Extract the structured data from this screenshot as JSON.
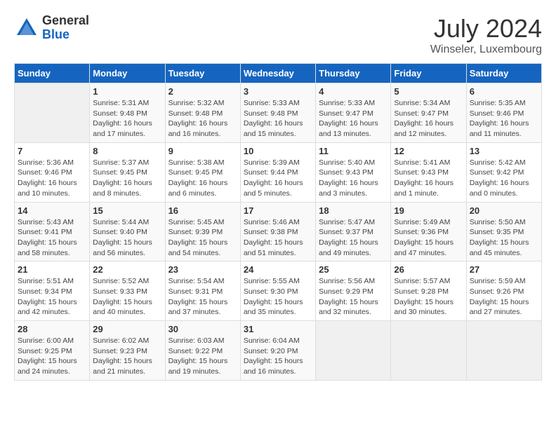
{
  "logo": {
    "general": "General",
    "blue": "Blue"
  },
  "title": "July 2024",
  "subtitle": "Winseler, Luxembourg",
  "days_of_week": [
    "Sunday",
    "Monday",
    "Tuesday",
    "Wednesday",
    "Thursday",
    "Friday",
    "Saturday"
  ],
  "weeks": [
    [
      {
        "day": "",
        "info": ""
      },
      {
        "day": "1",
        "info": "Sunrise: 5:31 AM\nSunset: 9:48 PM\nDaylight: 16 hours\nand 17 minutes."
      },
      {
        "day": "2",
        "info": "Sunrise: 5:32 AM\nSunset: 9:48 PM\nDaylight: 16 hours\nand 16 minutes."
      },
      {
        "day": "3",
        "info": "Sunrise: 5:33 AM\nSunset: 9:48 PM\nDaylight: 16 hours\nand 15 minutes."
      },
      {
        "day": "4",
        "info": "Sunrise: 5:33 AM\nSunset: 9:47 PM\nDaylight: 16 hours\nand 13 minutes."
      },
      {
        "day": "5",
        "info": "Sunrise: 5:34 AM\nSunset: 9:47 PM\nDaylight: 16 hours\nand 12 minutes."
      },
      {
        "day": "6",
        "info": "Sunrise: 5:35 AM\nSunset: 9:46 PM\nDaylight: 16 hours\nand 11 minutes."
      }
    ],
    [
      {
        "day": "7",
        "info": "Sunrise: 5:36 AM\nSunset: 9:46 PM\nDaylight: 16 hours\nand 10 minutes."
      },
      {
        "day": "8",
        "info": "Sunrise: 5:37 AM\nSunset: 9:45 PM\nDaylight: 16 hours\nand 8 minutes."
      },
      {
        "day": "9",
        "info": "Sunrise: 5:38 AM\nSunset: 9:45 PM\nDaylight: 16 hours\nand 6 minutes."
      },
      {
        "day": "10",
        "info": "Sunrise: 5:39 AM\nSunset: 9:44 PM\nDaylight: 16 hours\nand 5 minutes."
      },
      {
        "day": "11",
        "info": "Sunrise: 5:40 AM\nSunset: 9:43 PM\nDaylight: 16 hours\nand 3 minutes."
      },
      {
        "day": "12",
        "info": "Sunrise: 5:41 AM\nSunset: 9:43 PM\nDaylight: 16 hours\nand 1 minute."
      },
      {
        "day": "13",
        "info": "Sunrise: 5:42 AM\nSunset: 9:42 PM\nDaylight: 16 hours\nand 0 minutes."
      }
    ],
    [
      {
        "day": "14",
        "info": "Sunrise: 5:43 AM\nSunset: 9:41 PM\nDaylight: 15 hours\nand 58 minutes."
      },
      {
        "day": "15",
        "info": "Sunrise: 5:44 AM\nSunset: 9:40 PM\nDaylight: 15 hours\nand 56 minutes."
      },
      {
        "day": "16",
        "info": "Sunrise: 5:45 AM\nSunset: 9:39 PM\nDaylight: 15 hours\nand 54 minutes."
      },
      {
        "day": "17",
        "info": "Sunrise: 5:46 AM\nSunset: 9:38 PM\nDaylight: 15 hours\nand 51 minutes."
      },
      {
        "day": "18",
        "info": "Sunrise: 5:47 AM\nSunset: 9:37 PM\nDaylight: 15 hours\nand 49 minutes."
      },
      {
        "day": "19",
        "info": "Sunrise: 5:49 AM\nSunset: 9:36 PM\nDaylight: 15 hours\nand 47 minutes."
      },
      {
        "day": "20",
        "info": "Sunrise: 5:50 AM\nSunset: 9:35 PM\nDaylight: 15 hours\nand 45 minutes."
      }
    ],
    [
      {
        "day": "21",
        "info": "Sunrise: 5:51 AM\nSunset: 9:34 PM\nDaylight: 15 hours\nand 42 minutes."
      },
      {
        "day": "22",
        "info": "Sunrise: 5:52 AM\nSunset: 9:33 PM\nDaylight: 15 hours\nand 40 minutes."
      },
      {
        "day": "23",
        "info": "Sunrise: 5:54 AM\nSunset: 9:31 PM\nDaylight: 15 hours\nand 37 minutes."
      },
      {
        "day": "24",
        "info": "Sunrise: 5:55 AM\nSunset: 9:30 PM\nDaylight: 15 hours\nand 35 minutes."
      },
      {
        "day": "25",
        "info": "Sunrise: 5:56 AM\nSunset: 9:29 PM\nDaylight: 15 hours\nand 32 minutes."
      },
      {
        "day": "26",
        "info": "Sunrise: 5:57 AM\nSunset: 9:28 PM\nDaylight: 15 hours\nand 30 minutes."
      },
      {
        "day": "27",
        "info": "Sunrise: 5:59 AM\nSunset: 9:26 PM\nDaylight: 15 hours\nand 27 minutes."
      }
    ],
    [
      {
        "day": "28",
        "info": "Sunrise: 6:00 AM\nSunset: 9:25 PM\nDaylight: 15 hours\nand 24 minutes."
      },
      {
        "day": "29",
        "info": "Sunrise: 6:02 AM\nSunset: 9:23 PM\nDaylight: 15 hours\nand 21 minutes."
      },
      {
        "day": "30",
        "info": "Sunrise: 6:03 AM\nSunset: 9:22 PM\nDaylight: 15 hours\nand 19 minutes."
      },
      {
        "day": "31",
        "info": "Sunrise: 6:04 AM\nSunset: 9:20 PM\nDaylight: 15 hours\nand 16 minutes."
      },
      {
        "day": "",
        "info": ""
      },
      {
        "day": "",
        "info": ""
      },
      {
        "day": "",
        "info": ""
      }
    ]
  ]
}
